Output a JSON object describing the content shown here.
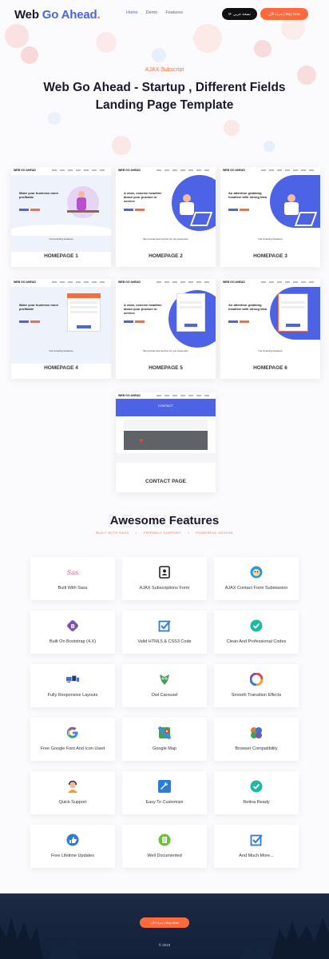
{
  "header": {
    "logo_word1": "Web",
    "logo_word2": "Go Ahead",
    "logo_dot": ".",
    "nav": [
      "Home",
      "Demo",
      "Features"
    ],
    "btn_arabic": "نسخة عربي",
    "btn_buy": "شراء الآن | Buy Now"
  },
  "hero": {
    "subtitle": "AJAX Subscript",
    "title_line1": "Web Go Ahead - Startup , Different Fields",
    "title_line2": "Landing Page Template"
  },
  "demos": [
    {
      "caption": "HOMEPAGE 1",
      "logo": "WEB GO AHEAD",
      "headline": "Make your business more profitable",
      "footer": "Our Amazing Features"
    },
    {
      "caption": "HOMEPAGE 2",
      "logo": "WEB GO AHEAD",
      "headline": "A clear, concise headline about your product or service",
      "footer": "We provide best service for you customers"
    },
    {
      "caption": "HOMEPAGE 3",
      "logo": "WEB GO AHEAD",
      "headline": "An attention grabbing headline with strong idea",
      "footer": "Our Amazing Features"
    },
    {
      "caption": "HOMEPAGE 4",
      "logo": "WEB GO AHEAD",
      "headline": "Make your business more profitable",
      "footer": "Our Amazing Features"
    },
    {
      "caption": "HOMEPAGE 5",
      "logo": "WEB GO AHEAD",
      "headline": "A clear, concise headline about your product or service",
      "footer": "We provide best service for you customers"
    },
    {
      "caption": "HOMEPAGE 6",
      "logo": "WEB GO AHEAD",
      "headline": "An attention grabbing headline with strong idea",
      "footer": "Our Amazing Features"
    },
    {
      "caption": "CONTACT PAGE",
      "logo": "WEB GO AHEAD",
      "headline": "CONTACT",
      "footer": ""
    }
  ],
  "features_section": {
    "title": "Awesome Features",
    "ghost": "FEATURES",
    "tags": [
      "BUILT WITH SASS",
      "FRIENDLY SUPPORT",
      "POWERFUL DESIGN"
    ]
  },
  "features": [
    {
      "label": "Built With Sass",
      "icon": "sass-icon",
      "color": "#cd6799"
    },
    {
      "label": "AJAX Subscriptions Form",
      "icon": "address-book-icon",
      "color": "#222222"
    },
    {
      "label": "AJAX Contact Form Submission",
      "icon": "mailchimp-icon",
      "color": "#2b9bd8"
    },
    {
      "label": "Built On Bootstrap (4.X)",
      "icon": "bootstrap-icon",
      "color": "#7952b3"
    },
    {
      "label": "Valid HTML5 & CSS3 Code",
      "icon": "checkbox-icon",
      "color": "#2b7bd8"
    },
    {
      "label": "Clean And Professional Codes",
      "icon": "check-circle-icon",
      "color": "#1fb8a0"
    },
    {
      "label": "Fully Responsive Layouts",
      "icon": "devices-icon",
      "color": "#3b6fd8"
    },
    {
      "label": "Owl Carousel",
      "icon": "owl-icon",
      "color": "#3aa05a"
    },
    {
      "label": "Smooth Transition Effects",
      "icon": "swirl-icon",
      "color": "#e04a3a"
    },
    {
      "label": "Free Google Font And Icon Used",
      "icon": "google-icon",
      "color": "#4285f4"
    },
    {
      "label": "Google Map",
      "icon": "google-map-icon",
      "color": "#34a853"
    },
    {
      "label": "Browser Compatibility",
      "icon": "browsers-icon",
      "color": "#e8743b"
    },
    {
      "label": "Quick Support",
      "icon": "support-agent-icon",
      "color": "#f0a030"
    },
    {
      "label": "Easy To Customize",
      "icon": "wrench-icon",
      "color": "#2b7bd8"
    },
    {
      "label": "Retina Ready",
      "icon": "check-circle-icon",
      "color": "#1fb8a0"
    },
    {
      "label": "Free Lifetime Updates",
      "icon": "thumbs-up-icon",
      "color": "#2b7bd8"
    },
    {
      "label": "Well Documented",
      "icon": "document-icon",
      "color": "#6cbf3a"
    },
    {
      "label": "And Much More...",
      "icon": "checkbox-icon",
      "color": "#2b7bd8"
    }
  ],
  "footer": {
    "btn": "شراء الآن | Buy Now",
    "copyright": "© 2019"
  },
  "colors": {
    "accent": "#4c63e6",
    "orange": "#ff6a3d",
    "dark": "#1a1a2e"
  }
}
